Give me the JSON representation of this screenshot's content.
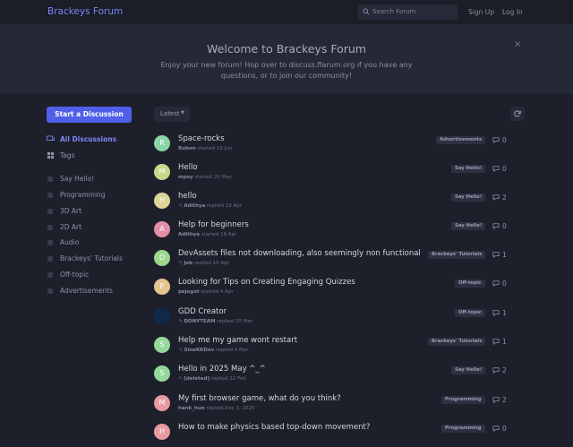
{
  "header": {
    "logo": "Brackeys Forum",
    "search_placeholder": "Search Forum",
    "sign_up": "Sign Up",
    "log_in": "Log In"
  },
  "hero": {
    "title": "Welcome to Brackeys Forum",
    "text": "Enjoy your new forum! Hop over to discuss.flarum.org if you have any questions, or to join our community!",
    "close": "×"
  },
  "sidebar": {
    "start_button": "Start a Discussion",
    "all_discussions": "All Discussions",
    "tags": "Tags",
    "tag_items": [
      "Say Hello!",
      "Programming",
      "3D Art",
      "2D Art",
      "Audio",
      "Brackeys' Tutorials",
      "Off-topic",
      "Advertisements"
    ]
  },
  "toolbar": {
    "sort": "Latest",
    "refresh_icon": "refresh-icon"
  },
  "colors": {
    "accent": "#4f5fe8",
    "link": "#7c88f7",
    "background": "#1d1f2a"
  },
  "discussions": [
    {
      "initial": "R",
      "color": "#8ad5a7",
      "title": "Space-rocks",
      "reply_icon": false,
      "user": "Ruben",
      "action": "started",
      "time": "15 Jun",
      "tag": "Advertisements",
      "count": "0"
    },
    {
      "initial": "M",
      "color": "#c9d88a",
      "title": "Hello",
      "reply_icon": false,
      "user": "mpsy",
      "action": "started",
      "time": "20 May",
      "tag": "Say Hello!",
      "count": "0"
    },
    {
      "initial": "H",
      "color": "#dcd597",
      "title": "hello",
      "reply_icon": true,
      "user": "Adithya",
      "action": "replied",
      "time": "19 Apr",
      "tag": "Say Hello!",
      "count": "2"
    },
    {
      "initial": "A",
      "color": "#e38ea7",
      "title": "Help for beginners",
      "reply_icon": false,
      "user": "Adithya",
      "action": "started",
      "time": "19 Apr",
      "tag": "Say Hello!",
      "count": "0"
    },
    {
      "initial": "D",
      "color": "#9bd68e",
      "title": "DevAssets files not downloading, also seemingly non functional",
      "reply_icon": true,
      "user": "Job",
      "action": "replied",
      "time": "15 Apr",
      "tag": "Brackeys' Tutorials",
      "count": "1"
    },
    {
      "initial": "P",
      "color": "#e3c58f",
      "title": "Looking for Tips on Creating Engaging Quizzes",
      "reply_icon": false,
      "user": "pejegot",
      "action": "started",
      "time": "4 Apr",
      "tag": "Off-topic",
      "count": "0"
    },
    {
      "initial": "",
      "color": "#0e2a4a",
      "title": "GDD Creator",
      "reply_icon": true,
      "user": "DONYTEAM",
      "action": "replied",
      "time": "20 Mar",
      "tag": "Off-topic",
      "count": "1"
    },
    {
      "initial": "S",
      "color": "#94d99a",
      "title": "Help me my game wont restart",
      "reply_icon": true,
      "user": "SineKKDev",
      "action": "replied",
      "time": "4 Mar",
      "tag": "Brackeys' Tutorials",
      "count": "1"
    },
    {
      "initial": "S",
      "color": "#94d99a",
      "title": "Hello in 2025 May ^_^",
      "reply_icon": true,
      "user": "[deleted]",
      "action": "replied",
      "time": "12 Feb",
      "tag": "Say Hello!",
      "count": "2"
    },
    {
      "initial": "M",
      "color": "#e89aa0",
      "title": "My first browser game, what do you think?",
      "reply_icon": false,
      "user": "hank_hun",
      "action": "replied",
      "time": "Dec 3, 2025",
      "tag": "Programming",
      "count": "2"
    },
    {
      "initial": "H",
      "color": "#e89aa0",
      "title": "How to make physics based top-down movement?",
      "reply_icon": false,
      "user": "",
      "action": "",
      "time": "",
      "tag": "Programming",
      "count": "0"
    }
  ]
}
